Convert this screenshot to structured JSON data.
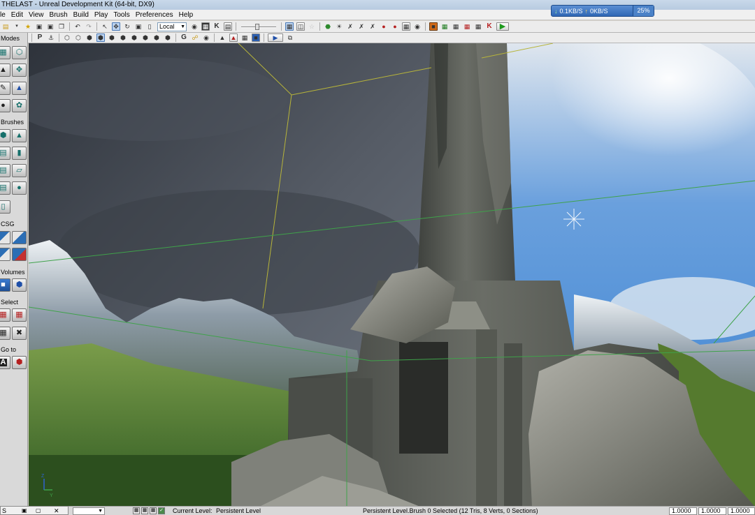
{
  "window": {
    "title": "THELAST - Unreal Development Kit (64-bit, DX9)"
  },
  "net_meter": {
    "download": "0.1KB/S",
    "upload": "0KB/S",
    "percent": "25%"
  },
  "menu": [
    "le",
    "Edit",
    "View",
    "Brush",
    "Build",
    "Play",
    "Tools",
    "Preferences",
    "Help"
  ],
  "toolbar": {
    "transform_space": "Local",
    "kismet_letter": "K",
    "p_letter": "P",
    "g_letter": "G"
  },
  "modes_panel": {
    "modes_label": "Modes",
    "brushes_label": "Brushes",
    "csg_label": "CSG",
    "volumes_label": "Volumes",
    "select_label": "Select",
    "goto_label": "Go to",
    "goto_letter": "A"
  },
  "statusbar": {
    "current_level_label": "Current Level:",
    "current_level_value": "Persistent Level",
    "selection_info": "Persistent Level.Brush  0 Selected (12 Tris, 8 Verts, 0 Sections)",
    "scale_x": "1.0000",
    "scale_y": "1.0000",
    "scale_z": "1.0000",
    "taskbar_letter": "S"
  },
  "colors": {
    "sky_top": "#2e333b",
    "sky_blue": "#4f8fd6",
    "mountain": "#8e9ca8",
    "grass": "#5f8a3a",
    "castle_stone": "#5c5e58",
    "brush_wire_yellow": "#b7b43a",
    "brush_wire_green": "#3fa24a",
    "play_green": "#1d9a1d"
  }
}
